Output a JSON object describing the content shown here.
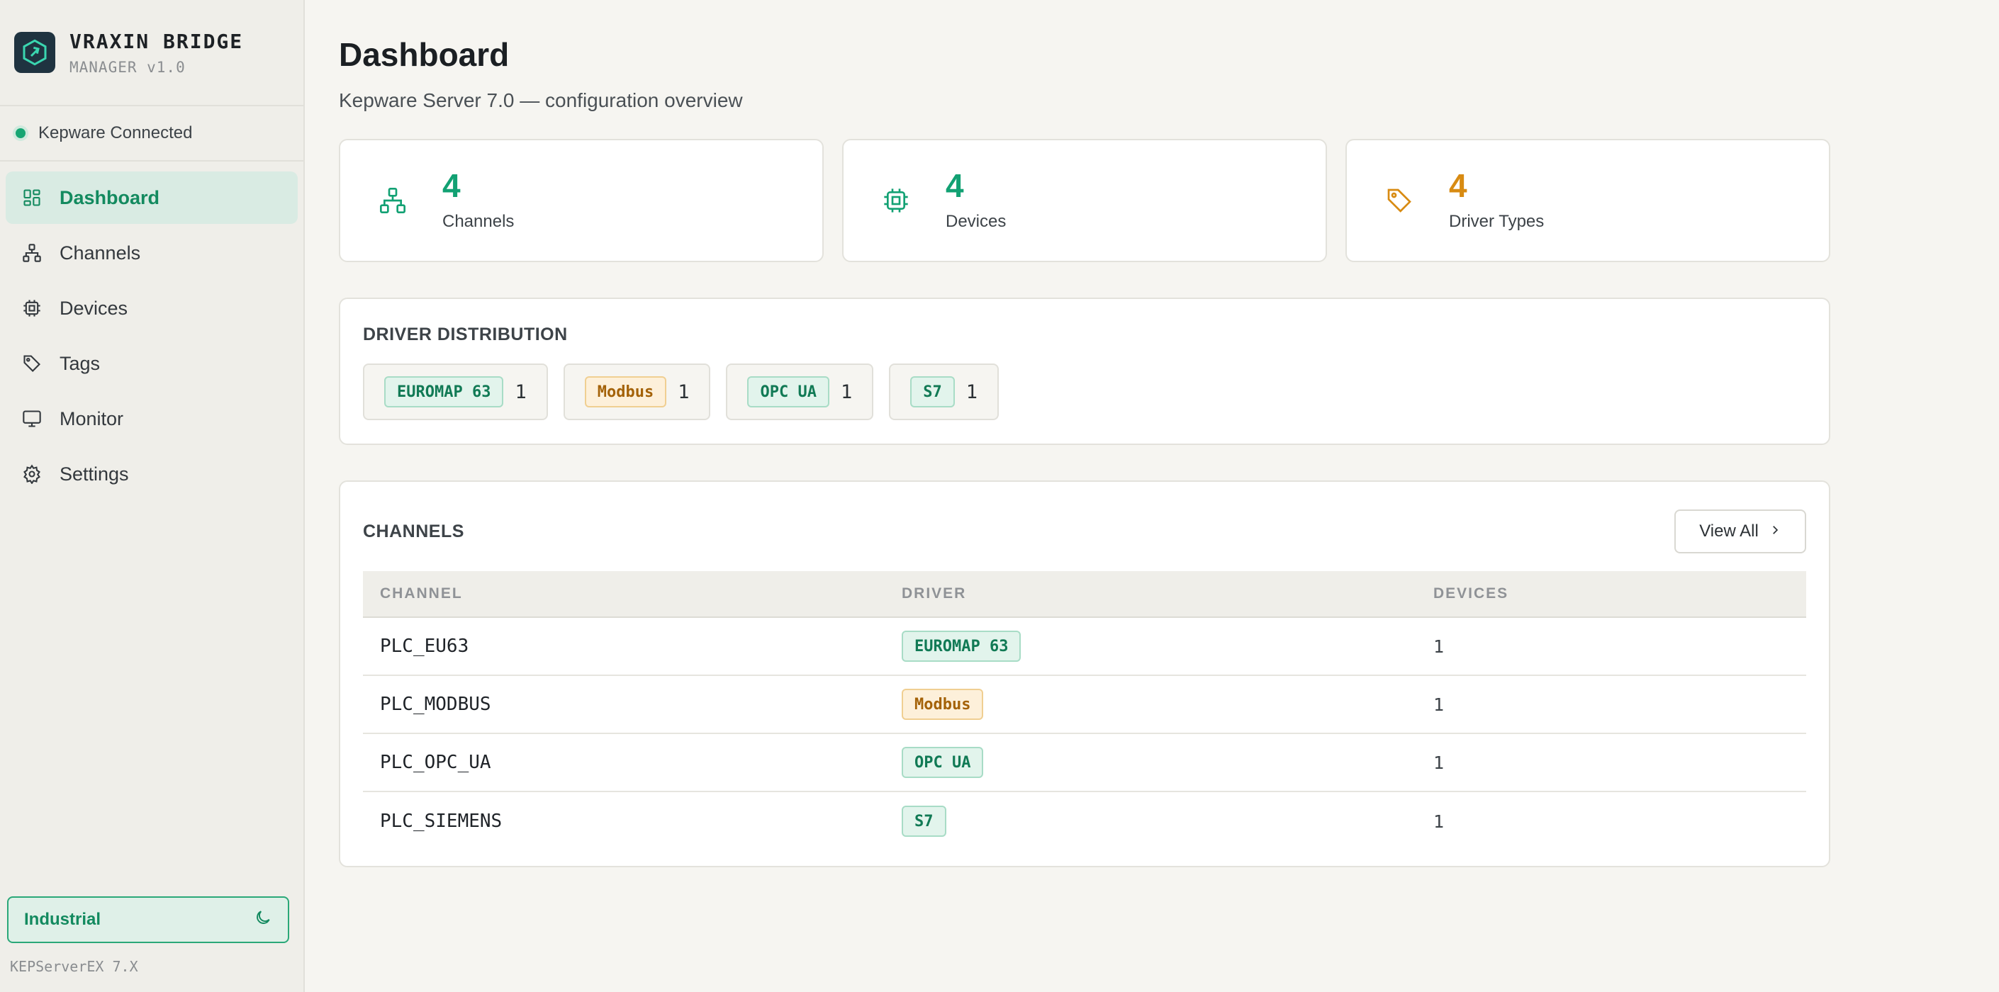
{
  "brand": {
    "title": "VRAXIN BRIDGE",
    "subtitle": "MANAGER v1.0"
  },
  "connection": {
    "status": "Kepware Connected",
    "color": "#17a673"
  },
  "nav": [
    {
      "label": "Dashboard",
      "icon": "dashboard-icon",
      "active": true
    },
    {
      "label": "Channels",
      "icon": "network-icon"
    },
    {
      "label": "Devices",
      "icon": "chip-icon"
    },
    {
      "label": "Tags",
      "icon": "tag-icon"
    },
    {
      "label": "Monitor",
      "icon": "monitor-icon"
    },
    {
      "label": "Settings",
      "icon": "gear-icon"
    }
  ],
  "theme": {
    "label": "Industrial",
    "icon": "moon-icon"
  },
  "footer": {
    "version": "KEPServerEX 7.X"
  },
  "page": {
    "title": "Dashboard",
    "subtitle": "Kepware Server 7.0 — configuration overview"
  },
  "stats": [
    {
      "value": "4",
      "label": "Channels",
      "icon": "network-icon",
      "color": "#12a173"
    },
    {
      "value": "4",
      "label": "Devices",
      "icon": "chip-icon",
      "color": "#12a173"
    },
    {
      "value": "4",
      "label": "Driver Types",
      "icon": "tag-icon",
      "color": "#d88b12"
    }
  ],
  "distribution": {
    "title": "DRIVER DISTRIBUTION",
    "items": [
      {
        "driver": "EUROMAP 63",
        "count": "1",
        "tone": "green"
      },
      {
        "driver": "Modbus",
        "count": "1",
        "tone": "amber"
      },
      {
        "driver": "OPC UA",
        "count": "1",
        "tone": "green"
      },
      {
        "driver": "S7",
        "count": "1",
        "tone": "green"
      }
    ]
  },
  "channels": {
    "title": "CHANNELS",
    "view_all": "View All",
    "columns": [
      "CHANNEL",
      "DRIVER",
      "DEVICES"
    ],
    "rows": [
      {
        "channel": "PLC_EU63",
        "driver": "EUROMAP 63",
        "tone": "green",
        "devices": "1"
      },
      {
        "channel": "PLC_MODBUS",
        "driver": "Modbus",
        "tone": "amber",
        "devices": "1"
      },
      {
        "channel": "PLC_OPC_UA",
        "driver": "OPC UA",
        "tone": "green",
        "devices": "1"
      },
      {
        "channel": "PLC_SIEMENS",
        "driver": "S7",
        "tone": "green",
        "devices": "1"
      }
    ]
  }
}
